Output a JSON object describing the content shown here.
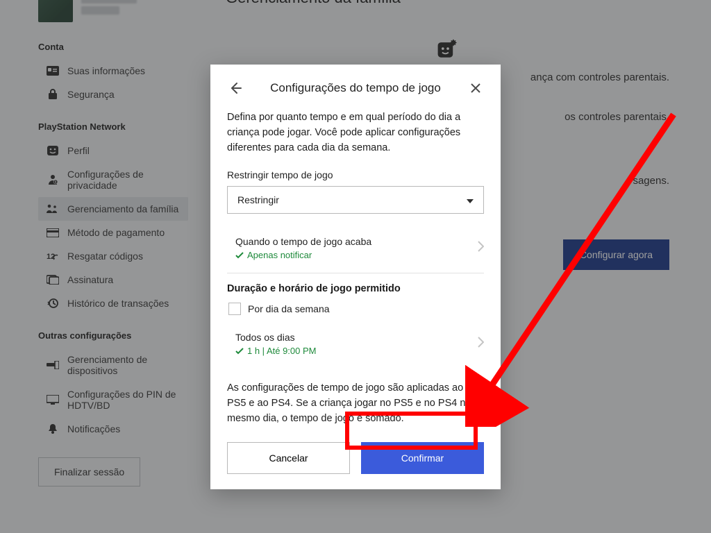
{
  "sidebar": {
    "sections": {
      "account": "Conta",
      "psn": "PlayStation Network",
      "other": "Outras configurações"
    },
    "items": {
      "info": "Suas informações",
      "security": "Segurança",
      "profile": "Perfil",
      "privacy": "Configurações de privacidade",
      "family": "Gerenciamento da família",
      "payment": "Método de pagamento",
      "redeem": "Resgatar códigos",
      "subscription": "Assinatura",
      "transactions": "Histórico de transações",
      "devices": "Gerenciamento de dispositivos",
      "pin": "Configurações do PIN de HDTV/BD",
      "notifications": "Notificações"
    },
    "logout": "Finalizar sessão"
  },
  "main": {
    "title": "Gerenciamento da família",
    "line1_suffix": "ança com controles parentais.",
    "line2_suffix": "os controles parentais.",
    "line3_suffix": "sagens.",
    "cta": "Configurar agora"
  },
  "modal": {
    "title": "Configurações do tempo de jogo",
    "desc": "Defina por quanto tempo e em qual período do dia a criança pode jogar. Você pode aplicar configurações diferentes para cada dia da semana.",
    "restrict_label": "Restringir tempo de jogo",
    "restrict_value": "Restringir",
    "timeout_title": "Quando o tempo de jogo acaba",
    "timeout_value": "Apenas notificar",
    "duration_head": "Duração e horário de jogo permitido",
    "per_day_label": "Por dia da semana",
    "all_days_title": "Todos os dias",
    "all_days_value": "1 h | Até 9:00 PM",
    "footnote": "As configurações de tempo de jogo são aplicadas ao PS5 e ao PS4. Se a criança jogar no PS5 e no PS4 no mesmo dia, o tempo de jogo é somado.",
    "cancel": "Cancelar",
    "confirm": "Confirmar"
  }
}
